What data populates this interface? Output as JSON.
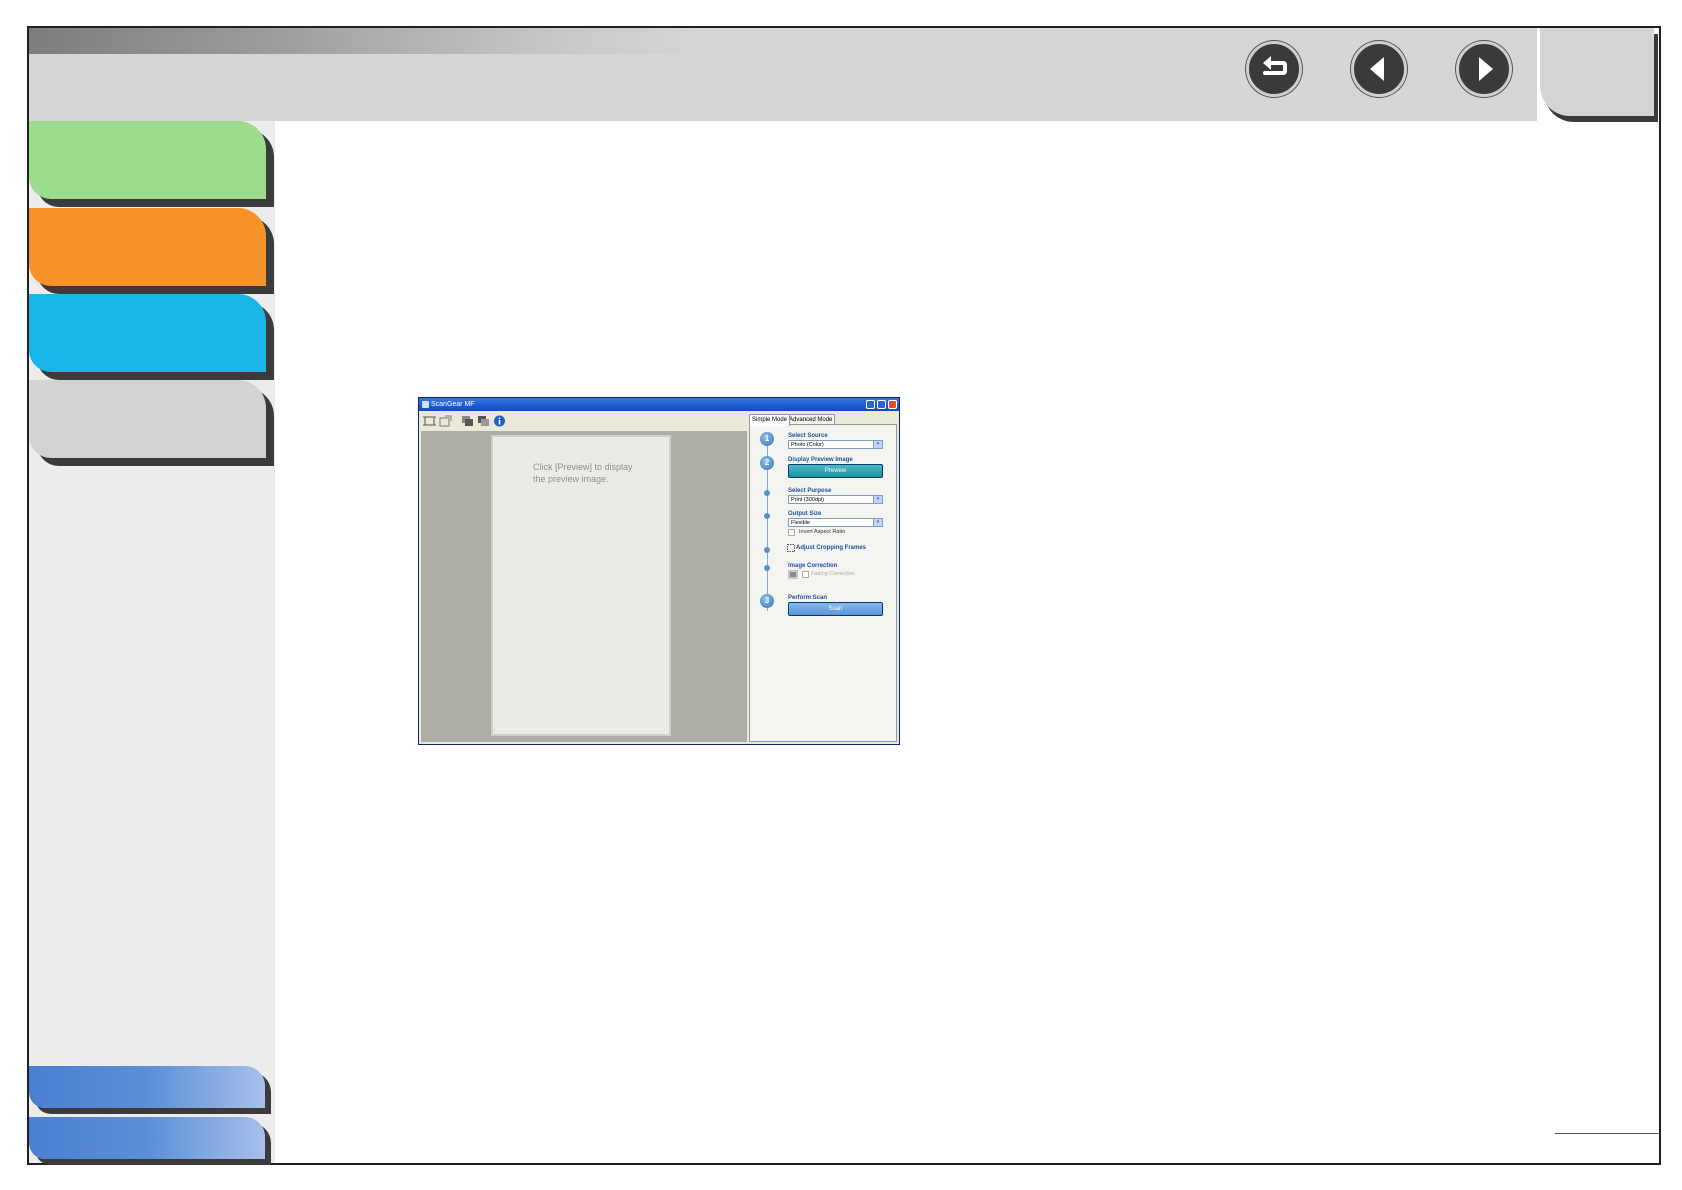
{
  "nav": {
    "back_icon": "back-return-icon",
    "prev_icon": "previous-page-icon",
    "next_icon": "next-page-icon"
  },
  "scanner_window": {
    "title": "ScanGear MF",
    "preview_hint": "Click [Preview] to display\nthe preview image.",
    "tabs": [
      {
        "label": "Simple Mode",
        "active": true
      },
      {
        "label": "Advanced Mode",
        "active": false
      }
    ],
    "steps": {
      "select_source": {
        "number": "1",
        "label": "Select Source",
        "value": "Photo (Color)"
      },
      "display_preview": {
        "number": "2",
        "label": "Display Preview Image",
        "button": "Preview"
      },
      "select_purpose": {
        "label": "Select Purpose",
        "value": "Print (300dpi)"
      },
      "output_size": {
        "label": "Output Size",
        "value": "Flexible",
        "checkbox": "Invert Aspect Ratio"
      },
      "adjust_cropping": {
        "label": "Adjust Cropping Frames"
      },
      "image_correction": {
        "label": "Image Correction",
        "checkbox": "Fading Correction"
      },
      "perform_scan": {
        "number": "3",
        "label": "Perform Scan",
        "button": "Scan"
      }
    }
  },
  "colors": {
    "tab_green": "#9ddb8d",
    "tab_orange": "#f7922a",
    "tab_blue": "#19b5e8",
    "tab_gray": "#d3d3d3",
    "tab_bottom": "#4a7fd1"
  }
}
